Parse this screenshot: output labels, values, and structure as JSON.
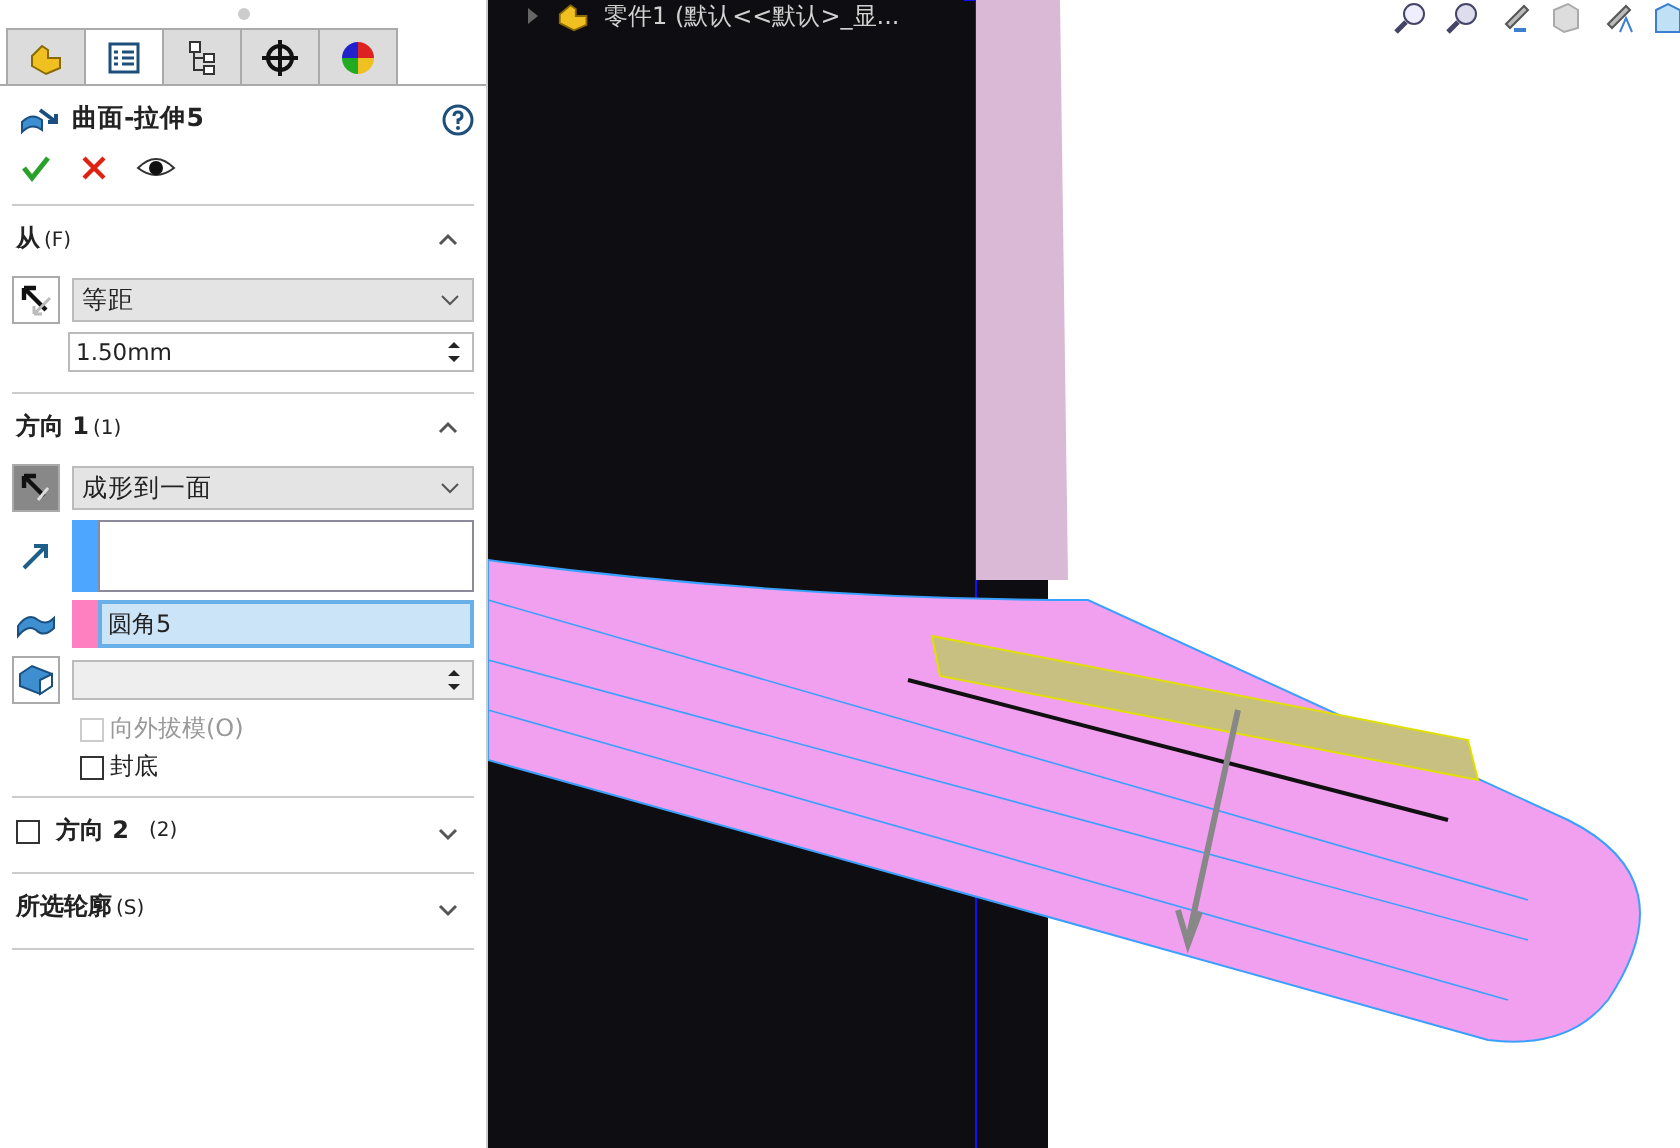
{
  "tabs": [
    {
      "selected": false
    },
    {
      "selected": true
    },
    {
      "selected": false
    },
    {
      "selected": false
    },
    {
      "selected": false
    }
  ],
  "feature": {
    "title": "曲面-拉伸5"
  },
  "from_section": {
    "title": "从",
    "key": "(F)",
    "expanded": true,
    "condition": "等距",
    "offset": "1.50mm"
  },
  "direction1": {
    "title": "方向 1",
    "key": "(1)",
    "expanded": true,
    "condition": "成形到一面",
    "selection_fields": [
      {
        "kind": "direction",
        "color": "#4da6ff",
        "selected": false
      },
      {
        "kind": "face",
        "value": "圆角5",
        "color": "#ff80c0",
        "selected": true
      }
    ],
    "checkboxes": [
      {
        "label": "向外拔模(O)",
        "checked": false,
        "disabled": true
      },
      {
        "label": "封底",
        "checked": false,
        "disabled": false
      }
    ]
  },
  "direction2": {
    "title": "方向 2",
    "key": "(2)",
    "expanded": false,
    "checked": false
  },
  "profiles_section": {
    "title": "所选轮廓",
    "key": "(S)",
    "expanded": false
  },
  "tree": {
    "root": "零件1  (默认<<默认>_显..."
  }
}
